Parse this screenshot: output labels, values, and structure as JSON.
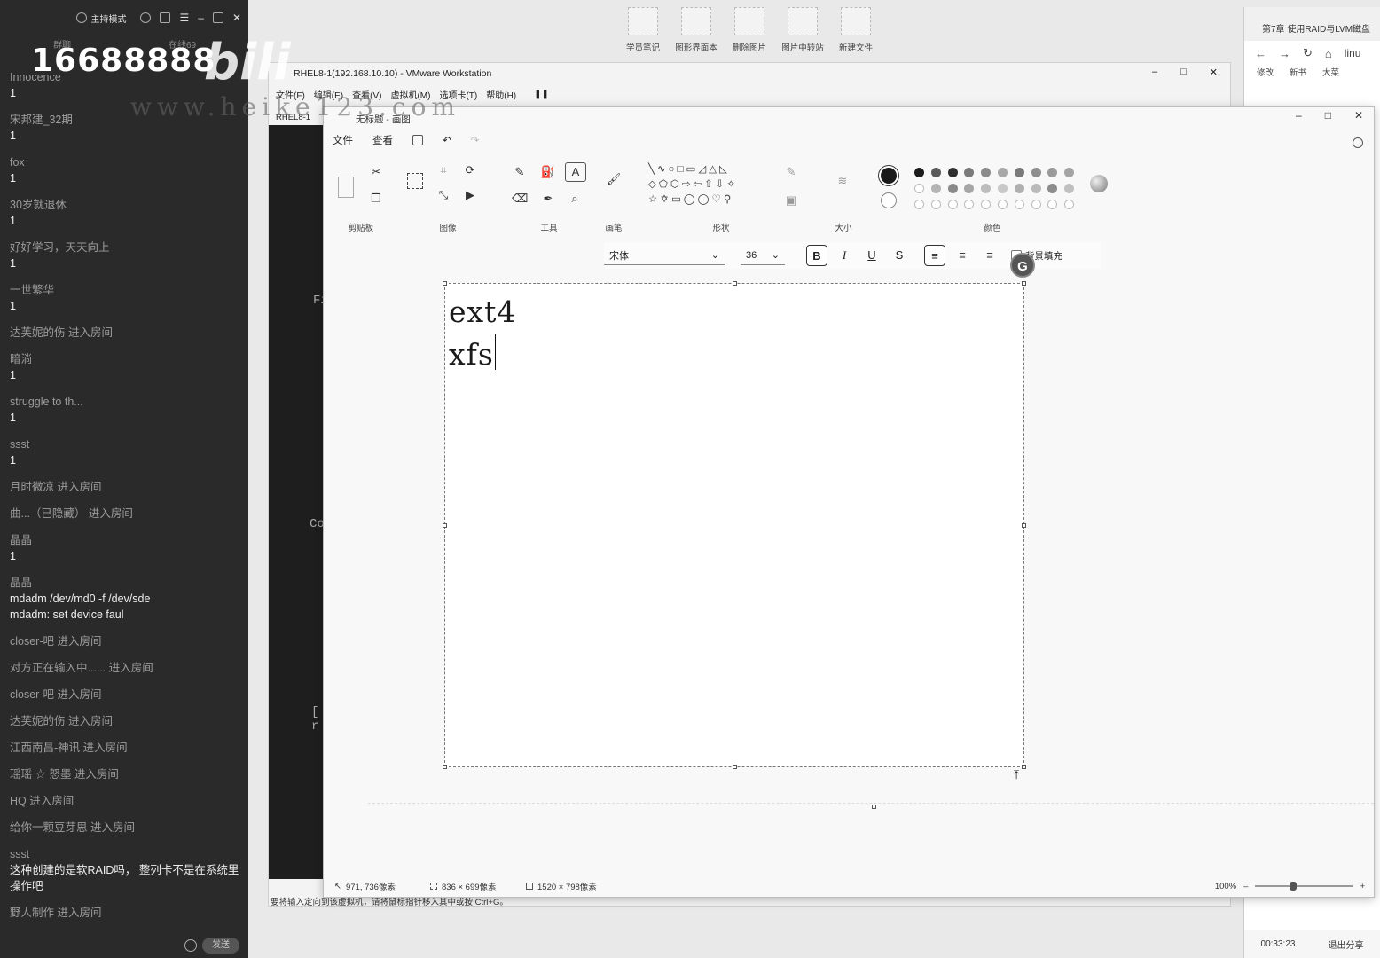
{
  "chat": {
    "mode_label": "主持模式",
    "tabs": [
      "群聊",
      "在线69"
    ],
    "messages": [
      {
        "user": "Innocence",
        "text": "1"
      },
      {
        "user": "宋邦建_32期",
        "text": "1"
      },
      {
        "user": "fox",
        "text": "1"
      },
      {
        "user": "30岁就退休",
        "text": "1"
      },
      {
        "user": "好好学习，天天向上",
        "text": "1"
      },
      {
        "user": "一世繁华",
        "text": "1"
      },
      {
        "system": "达芙妮的伤 进入房间"
      },
      {
        "user": "暗淌",
        "text": "1"
      },
      {
        "user": "struggle to th...",
        "text": "1"
      },
      {
        "user": "ssst",
        "text": "1"
      },
      {
        "system": "月时微凉 进入房间"
      },
      {
        "system": "曲...（已隐藏） 进入房间"
      },
      {
        "user": "晶晶",
        "text": "1"
      },
      {
        "user": "晶晶",
        "text": "mdadm /dev/md0 -f /dev/sde\nmdadm: set device faul"
      },
      {
        "system": "closer-吧    进入房间"
      },
      {
        "system": "对方正在输入中...... 进入房间"
      },
      {
        "system": "closer-吧    进入房间"
      },
      {
        "system": "达芙妮的伤 进入房间"
      },
      {
        "system": "江西南昌-神讯 进入房间"
      },
      {
        "system": "瑶瑶 ☆ 怒墨 进入房间"
      },
      {
        "system": "HQ 进入房间"
      },
      {
        "system": "给你一颗豆芽思 进入房间"
      },
      {
        "user": "ssst",
        "text": "这种创建的是软RAID吗， 整列卡不是在系统里操作吧"
      },
      {
        "system": "野人制作 进入房间"
      }
    ],
    "send_label": "发送"
  },
  "watermark": {
    "number": "16688888",
    "brand": "bili",
    "site": "www.heike123.com"
  },
  "desktop_icons": [
    "学员笔记",
    "图形界面本",
    "删除图片",
    "图片中转站",
    "新建文件"
  ],
  "browser": {
    "tab_title": "第7章 使用RAID与LVM磁盘",
    "url_fragment": "linu",
    "bookmarks": [
      "修改",
      "新书",
      "大菜"
    ],
    "timer": "00:33:23",
    "exit_share": "退出分享"
  },
  "vmware": {
    "title": "RHEL8-1(192.168.10.10) - VMware Workstation",
    "menu": [
      "文件(F)",
      "编辑(E)",
      "查看(V)",
      "虚拟机(M)",
      "选项卡(T)",
      "帮助(H)"
    ],
    "tab": "RHEL8-1",
    "status_text": "要将输入定向到该虚拟机，请将鼠标指针移入其中或按 Ctrl+G。",
    "console_chars": [
      "Fi",
      "Co",
      "[ r"
    ]
  },
  "paint": {
    "title": "无标题 - 画图",
    "menu": [
      "文件",
      "查看"
    ],
    "groups": {
      "clipboard": "剪贴板",
      "image": "图像",
      "tools": "工具",
      "brush": "画笔",
      "shapes": "形状",
      "size": "大小",
      "colors": "颜色"
    },
    "font_name": "宋体",
    "font_size": "36",
    "format": {
      "bold": "B",
      "italic": "I",
      "underline": "U",
      "strike": "S"
    },
    "fill_background": "背景填充",
    "text_lines": [
      "ext4",
      "xfs"
    ],
    "status": {
      "cursor": "971, 736像素",
      "selection": "836 × 699像素",
      "canvas_size": "1520 × 798像素",
      "zoom": "100%"
    },
    "zoom_level": 0.35
  }
}
